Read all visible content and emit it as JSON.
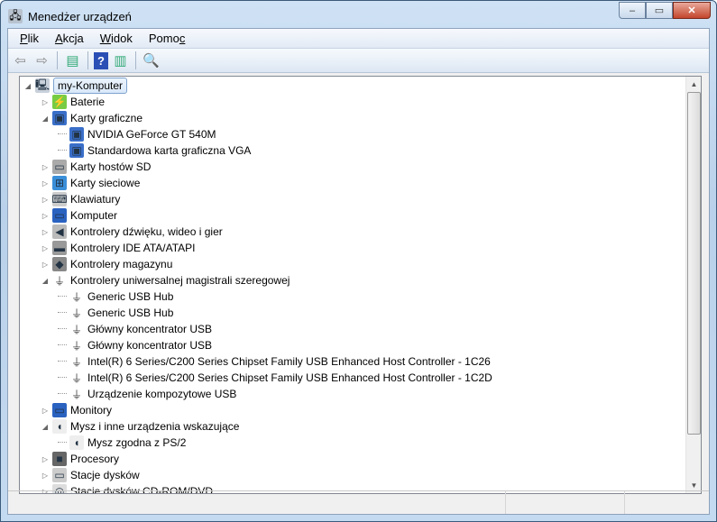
{
  "window": {
    "title": "Menedżer urządzeń",
    "minimize": "‒",
    "maximize": "▭",
    "close": "✕"
  },
  "menu": [
    {
      "pre": "",
      "u": "P",
      "post": "lik"
    },
    {
      "pre": "",
      "u": "A",
      "post": "kcja"
    },
    {
      "pre": "",
      "u": "W",
      "post": "idok"
    },
    {
      "pre": "Pomo",
      "u": "c",
      "post": ""
    }
  ],
  "toolbar": [
    "back-icon",
    "forward-icon",
    "show-hide-console-tree-icon",
    "help-icon",
    "show-action-pane-icon",
    "scan-hardware-icon"
  ],
  "tree": [
    {
      "label": "my-Komputer",
      "level": 0,
      "state": "expanded",
      "icon": "computer-icon",
      "selected": true
    },
    {
      "label": "Baterie",
      "level": 1,
      "state": "collapsed",
      "icon": "battery-icon"
    },
    {
      "label": "Karty graficzne",
      "level": 1,
      "state": "expanded",
      "icon": "display-adapter-icon"
    },
    {
      "label": "NVIDIA GeForce GT 540M",
      "level": 2,
      "state": "leaf",
      "icon": "display-adapter-icon"
    },
    {
      "label": "Standardowa karta graficzna VGA",
      "level": 2,
      "state": "leaf",
      "icon": "display-adapter-icon"
    },
    {
      "label": "Karty hostów SD",
      "level": 1,
      "state": "collapsed",
      "icon": "sd-host-icon"
    },
    {
      "label": "Karty sieciowe",
      "level": 1,
      "state": "collapsed",
      "icon": "network-adapter-icon"
    },
    {
      "label": "Klawiatury",
      "level": 1,
      "state": "collapsed",
      "icon": "keyboard-icon"
    },
    {
      "label": "Komputer",
      "level": 1,
      "state": "collapsed",
      "icon": "monitor-icon"
    },
    {
      "label": "Kontrolery dźwięku, wideo i gier",
      "level": 1,
      "state": "collapsed",
      "icon": "speaker-icon"
    },
    {
      "label": "Kontrolery IDE ATA/ATAPI",
      "level": 1,
      "state": "collapsed",
      "icon": "ide-controller-icon"
    },
    {
      "label": "Kontrolery magazynu",
      "level": 1,
      "state": "collapsed",
      "icon": "storage-controller-icon"
    },
    {
      "label": "Kontrolery uniwersalnej magistrali szeregowej",
      "level": 1,
      "state": "expanded",
      "icon": "usb-icon"
    },
    {
      "label": "Generic USB Hub",
      "level": 2,
      "state": "leaf",
      "icon": "usb-icon"
    },
    {
      "label": "Generic USB Hub",
      "level": 2,
      "state": "leaf",
      "icon": "usb-icon"
    },
    {
      "label": "Główny koncentrator USB",
      "level": 2,
      "state": "leaf",
      "icon": "usb-icon"
    },
    {
      "label": "Główny koncentrator USB",
      "level": 2,
      "state": "leaf",
      "icon": "usb-icon"
    },
    {
      "label": "Intel(R) 6 Series/C200 Series Chipset Family USB Enhanced Host Controller - 1C26",
      "level": 2,
      "state": "leaf",
      "icon": "usb-icon"
    },
    {
      "label": "Intel(R) 6 Series/C200 Series Chipset Family USB Enhanced Host Controller - 1C2D",
      "level": 2,
      "state": "leaf",
      "icon": "usb-icon"
    },
    {
      "label": "Urządzenie kompozytowe USB",
      "level": 2,
      "state": "leaf",
      "icon": "usb-icon"
    },
    {
      "label": "Monitory",
      "level": 1,
      "state": "collapsed",
      "icon": "monitor-icon"
    },
    {
      "label": "Mysz i inne urządzenia wskazujące",
      "level": 1,
      "state": "expanded",
      "icon": "mouse-icon"
    },
    {
      "label": "Mysz zgodna z PS/2",
      "level": 2,
      "state": "leaf",
      "icon": "mouse-icon"
    },
    {
      "label": "Procesory",
      "level": 1,
      "state": "collapsed",
      "icon": "processor-icon"
    },
    {
      "label": "Stacje dysków",
      "level": 1,
      "state": "collapsed",
      "icon": "disk-drive-icon"
    },
    {
      "label": "Stacje dysków CD-ROM/DVD",
      "level": 1,
      "state": "collapsed",
      "icon": "cdrom-icon"
    }
  ]
}
